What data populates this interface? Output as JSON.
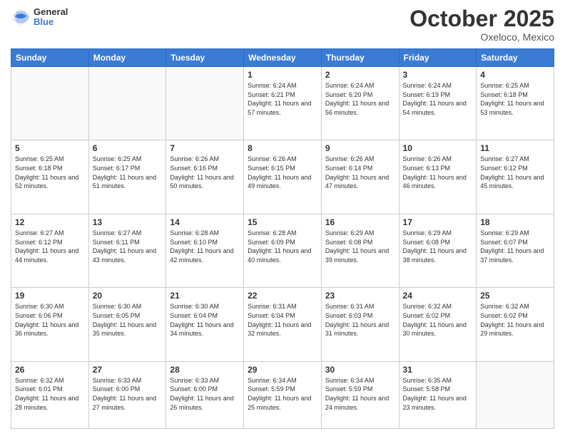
{
  "header": {
    "logo": {
      "general": "General",
      "blue": "Blue"
    },
    "title": "October 2025",
    "location": "Oxeloco, Mexico"
  },
  "calendar": {
    "days_of_week": [
      "Sunday",
      "Monday",
      "Tuesday",
      "Wednesday",
      "Thursday",
      "Friday",
      "Saturday"
    ],
    "weeks": [
      [
        {
          "day": "",
          "info": ""
        },
        {
          "day": "",
          "info": ""
        },
        {
          "day": "",
          "info": ""
        },
        {
          "day": "1",
          "info": "Sunrise: 6:24 AM\nSunset: 6:21 PM\nDaylight: 11 hours and 57 minutes."
        },
        {
          "day": "2",
          "info": "Sunrise: 6:24 AM\nSunset: 6:20 PM\nDaylight: 11 hours and 56 minutes."
        },
        {
          "day": "3",
          "info": "Sunrise: 6:24 AM\nSunset: 6:19 PM\nDaylight: 11 hours and 54 minutes."
        },
        {
          "day": "4",
          "info": "Sunrise: 6:25 AM\nSunset: 6:18 PM\nDaylight: 11 hours and 53 minutes."
        }
      ],
      [
        {
          "day": "5",
          "info": "Sunrise: 6:25 AM\nSunset: 6:18 PM\nDaylight: 11 hours and 52 minutes."
        },
        {
          "day": "6",
          "info": "Sunrise: 6:25 AM\nSunset: 6:17 PM\nDaylight: 11 hours and 51 minutes."
        },
        {
          "day": "7",
          "info": "Sunrise: 6:26 AM\nSunset: 6:16 PM\nDaylight: 11 hours and 50 minutes."
        },
        {
          "day": "8",
          "info": "Sunrise: 6:26 AM\nSunset: 6:15 PM\nDaylight: 11 hours and 49 minutes."
        },
        {
          "day": "9",
          "info": "Sunrise: 6:26 AM\nSunset: 6:14 PM\nDaylight: 11 hours and 47 minutes."
        },
        {
          "day": "10",
          "info": "Sunrise: 6:26 AM\nSunset: 6:13 PM\nDaylight: 11 hours and 46 minutes."
        },
        {
          "day": "11",
          "info": "Sunrise: 6:27 AM\nSunset: 6:12 PM\nDaylight: 11 hours and 45 minutes."
        }
      ],
      [
        {
          "day": "12",
          "info": "Sunrise: 6:27 AM\nSunset: 6:12 PM\nDaylight: 11 hours and 44 minutes."
        },
        {
          "day": "13",
          "info": "Sunrise: 6:27 AM\nSunset: 6:11 PM\nDaylight: 11 hours and 43 minutes."
        },
        {
          "day": "14",
          "info": "Sunrise: 6:28 AM\nSunset: 6:10 PM\nDaylight: 11 hours and 42 minutes."
        },
        {
          "day": "15",
          "info": "Sunrise: 6:28 AM\nSunset: 6:09 PM\nDaylight: 11 hours and 40 minutes."
        },
        {
          "day": "16",
          "info": "Sunrise: 6:29 AM\nSunset: 6:08 PM\nDaylight: 11 hours and 39 minutes."
        },
        {
          "day": "17",
          "info": "Sunrise: 6:29 AM\nSunset: 6:08 PM\nDaylight: 11 hours and 38 minutes."
        },
        {
          "day": "18",
          "info": "Sunrise: 6:29 AM\nSunset: 6:07 PM\nDaylight: 11 hours and 37 minutes."
        }
      ],
      [
        {
          "day": "19",
          "info": "Sunrise: 6:30 AM\nSunset: 6:06 PM\nDaylight: 11 hours and 36 minutes."
        },
        {
          "day": "20",
          "info": "Sunrise: 6:30 AM\nSunset: 6:05 PM\nDaylight: 11 hours and 35 minutes."
        },
        {
          "day": "21",
          "info": "Sunrise: 6:30 AM\nSunset: 6:04 PM\nDaylight: 11 hours and 34 minutes."
        },
        {
          "day": "22",
          "info": "Sunrise: 6:31 AM\nSunset: 6:04 PM\nDaylight: 11 hours and 32 minutes."
        },
        {
          "day": "23",
          "info": "Sunrise: 6:31 AM\nSunset: 6:03 PM\nDaylight: 11 hours and 31 minutes."
        },
        {
          "day": "24",
          "info": "Sunrise: 6:32 AM\nSunset: 6:02 PM\nDaylight: 11 hours and 30 minutes."
        },
        {
          "day": "25",
          "info": "Sunrise: 6:32 AM\nSunset: 6:02 PM\nDaylight: 11 hours and 29 minutes."
        }
      ],
      [
        {
          "day": "26",
          "info": "Sunrise: 6:32 AM\nSunset: 6:01 PM\nDaylight: 11 hours and 28 minutes."
        },
        {
          "day": "27",
          "info": "Sunrise: 6:33 AM\nSunset: 6:00 PM\nDaylight: 11 hours and 27 minutes."
        },
        {
          "day": "28",
          "info": "Sunrise: 6:33 AM\nSunset: 6:00 PM\nDaylight: 11 hours and 26 minutes."
        },
        {
          "day": "29",
          "info": "Sunrise: 6:34 AM\nSunset: 5:59 PM\nDaylight: 11 hours and 25 minutes."
        },
        {
          "day": "30",
          "info": "Sunrise: 6:34 AM\nSunset: 5:59 PM\nDaylight: 11 hours and 24 minutes."
        },
        {
          "day": "31",
          "info": "Sunrise: 6:35 AM\nSunset: 5:58 PM\nDaylight: 11 hours and 23 minutes."
        },
        {
          "day": "",
          "info": ""
        }
      ]
    ]
  }
}
